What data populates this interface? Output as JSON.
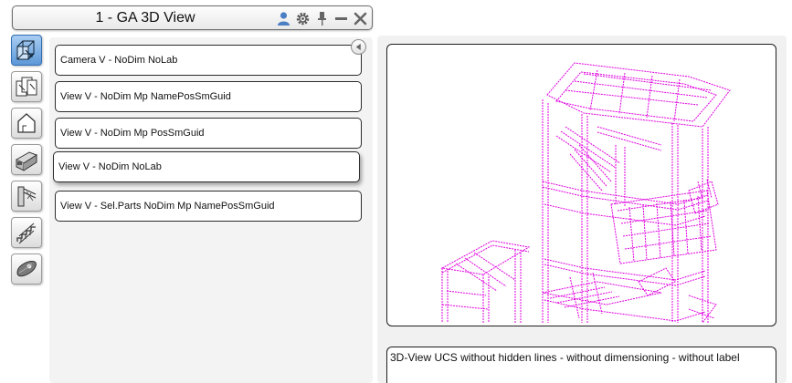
{
  "window": {
    "title": "1 - GA 3D View"
  },
  "titlebar_icons": [
    "user-icon",
    "gear-icon",
    "pin-icon",
    "minimize-icon",
    "close-icon"
  ],
  "toolbar": {
    "buttons": [
      {
        "icon": "general-arrangement-3d-icon",
        "active": true
      },
      {
        "icon": "multi-view-3d-icon",
        "active": false
      },
      {
        "icon": "house-outline-icon",
        "active": false
      },
      {
        "icon": "beam-section-icon",
        "active": false
      },
      {
        "icon": "column-detail-icon",
        "active": false
      },
      {
        "icon": "staircase-icon",
        "active": false
      },
      {
        "icon": "plate-part-icon",
        "active": false
      }
    ]
  },
  "views": [
    {
      "label": "Camera V - NoDim NoLab"
    },
    {
      "label": "View V - NoDim Mp NamePosSmGuid"
    },
    {
      "label": "View V - NoDim Mp PosSmGuid"
    },
    {
      "label": "View V - NoDim NoLab",
      "selected": true
    },
    {
      "label": "View V - Sel.Parts NoDim Mp NamePosSmGuid"
    }
  ],
  "preview": {
    "description": "3D-View UCS without hidden lines - without dimensioning - without label",
    "line_color": "#e000e0"
  },
  "colors": {
    "accent": "#5d98d8",
    "wireframe": "#e000e0"
  }
}
